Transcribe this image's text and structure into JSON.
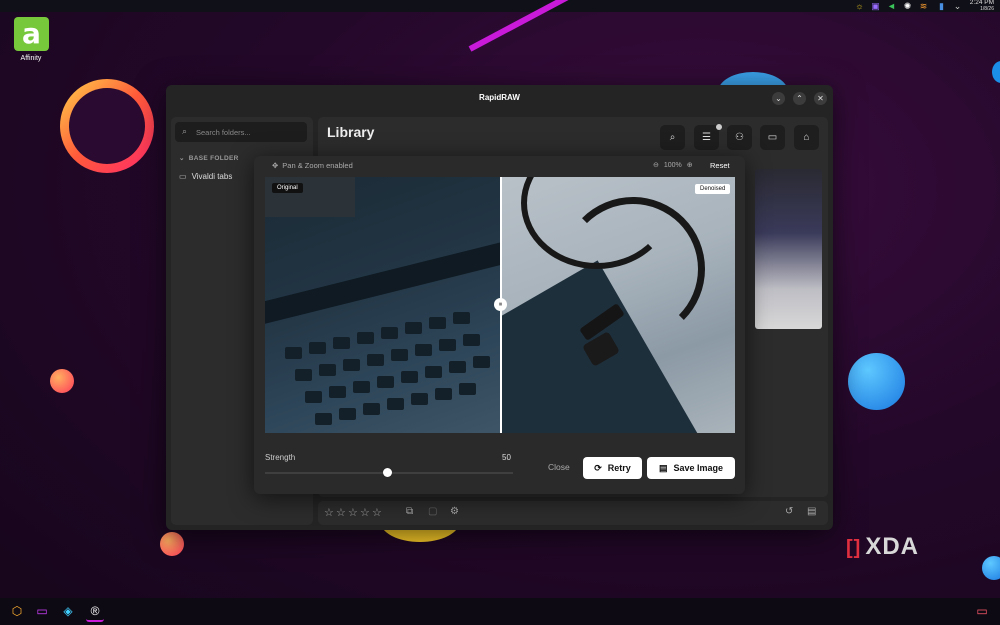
{
  "system_tray": {
    "icons": [
      "sun-icon",
      "clipboard-icon",
      "volume-icon",
      "brightness-icon",
      "wifi-icon",
      "battery-icon",
      "chevron-down-icon"
    ],
    "time": "2:24 PM",
    "date": "1/8/26"
  },
  "desktop": {
    "icon_label": "Affinity"
  },
  "window": {
    "title": "RapidRAW",
    "controls": [
      "minimize-icon",
      "maximize-icon",
      "close-icon"
    ]
  },
  "sidebar": {
    "search_placeholder": "Search folders...",
    "section_label": "BASE FOLDER",
    "folders": [
      {
        "label": "Vivaldi tabs"
      }
    ]
  },
  "library": {
    "title": "Library",
    "tools": [
      "search-icon",
      "sliders-icon",
      "people-icon",
      "folder-icon",
      "home-icon"
    ]
  },
  "denoise_modal": {
    "pan_zoom_label": "Pan & Zoom enabled",
    "zoom_level": "100%",
    "reset_label": "Reset",
    "original_tag": "Original",
    "denoised_tag": "Denoised",
    "strength_label": "Strength",
    "strength_value": "50",
    "strength_fraction": 0.5,
    "close_label": "Close",
    "retry_label": "Retry",
    "save_label": "Save Image"
  },
  "bottom_bar": {
    "rating_stars": 5,
    "icons": [
      "copy-icon",
      "paste-icon",
      "settings-icon",
      "undo-icon",
      "save-icon"
    ]
  },
  "watermark": "XDA",
  "colors": {
    "accent_green": "#78c83c",
    "wallpaper_magenta": "#c81ad8",
    "window_bg": "#242424"
  }
}
